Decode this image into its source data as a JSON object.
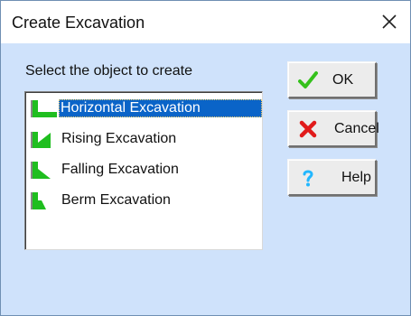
{
  "window": {
    "title": "Create Excavation",
    "close_glyph": "×"
  },
  "dialog": {
    "prompt": "Select the object to create",
    "items": [
      {
        "label": "Horizontal Excavation",
        "icon": "horizontal-excavation-icon",
        "selected": true
      },
      {
        "label": "Rising Excavation",
        "icon": "rising-excavation-icon",
        "selected": false
      },
      {
        "label": "Falling Excavation",
        "icon": "falling-excavation-icon",
        "selected": false
      },
      {
        "label": "Berm Excavation",
        "icon": "berm-excavation-icon",
        "selected": false
      }
    ]
  },
  "buttons": {
    "ok": {
      "label": "OK",
      "icon": "checkmark-icon",
      "color": "#35c11c"
    },
    "cancel": {
      "label": "Cancel",
      "icon": "red-x-icon",
      "color": "#e11b1b"
    },
    "help": {
      "label": "Help",
      "icon": "question-mark-icon",
      "color": "#22b7ff"
    }
  },
  "colors": {
    "dialog_background": "#cfe2fb",
    "selection_background": "#0a64c8",
    "icon_green": "#1fbe1f"
  }
}
